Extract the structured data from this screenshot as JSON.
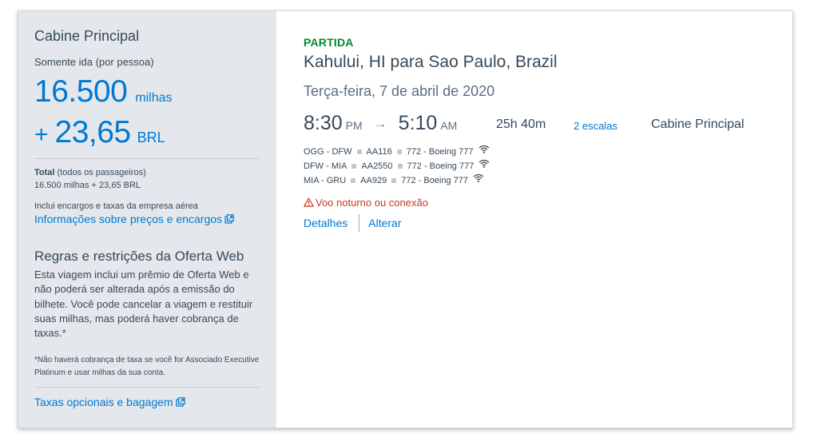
{
  "summary": {
    "cabin_title": "Cabine Principal",
    "trip_type": "Somente ida (por pessoa)",
    "miles_value": "16.500",
    "miles_unit": "milhas",
    "plus_sign": "+",
    "fee_value": "23,65",
    "fee_currency": "BRL",
    "total_label": "Total",
    "total_suffix": " (todos os passageiros)",
    "total_amount": "16.500 milhas + 23,65 BRL",
    "includes_text": "Inclui encargos e taxas da empresa aérea",
    "pricing_link": "Informações sobre preços e encargos"
  },
  "rules": {
    "title": "Regras e restrições da Oferta Web",
    "body": "Esta viagem inclui um prêmio de Oferta Web e não poderá ser alterada após a emissão do bilhete.  Você pode cancelar a viagem e restituir suas milhas, mas poderá haver cobrança de taxas.*",
    "note": "*Não haverá cobrança de taxa se você for Associado Executive Platinum e usar milhas da sua conta.",
    "baggage_link": "Taxas opcionais e bagagem"
  },
  "flight": {
    "label": "PARTIDA",
    "route": "Kahului, HI para Sao Paulo, Brazil",
    "date": "Terça-feira, 7 de abril de 2020",
    "depart_time": "8:30",
    "depart_ampm": "PM",
    "arrow": "→",
    "arrive_time": "5:10",
    "arrive_ampm": "AM",
    "duration": "25h 40m",
    "stops": "2 escalas",
    "cabin": "Cabine Principal",
    "segments": [
      {
        "route": "OGG - DFW",
        "flight": "AA116",
        "aircraft": "772 - Boeing 777"
      },
      {
        "route": "DFW - MIA",
        "flight": "AA2550",
        "aircraft": "772 - Boeing 777"
      },
      {
        "route": "MIA - GRU",
        "flight": "AA929",
        "aircraft": "772 - Boeing 777"
      }
    ],
    "warning": "Voo noturno ou conexão",
    "details_link": "Detalhes",
    "change_link": "Alterar"
  },
  "icons": {
    "external_link": "external-link-icon",
    "wifi": "wifi-icon",
    "warning": "warning-triangle-icon"
  },
  "colors": {
    "accent_blue": "#0078d2",
    "departure_green": "#008a2b",
    "warning_red": "#c8391f",
    "sidebar_bg": "#e4e8ec",
    "text_dark": "#36495a"
  }
}
